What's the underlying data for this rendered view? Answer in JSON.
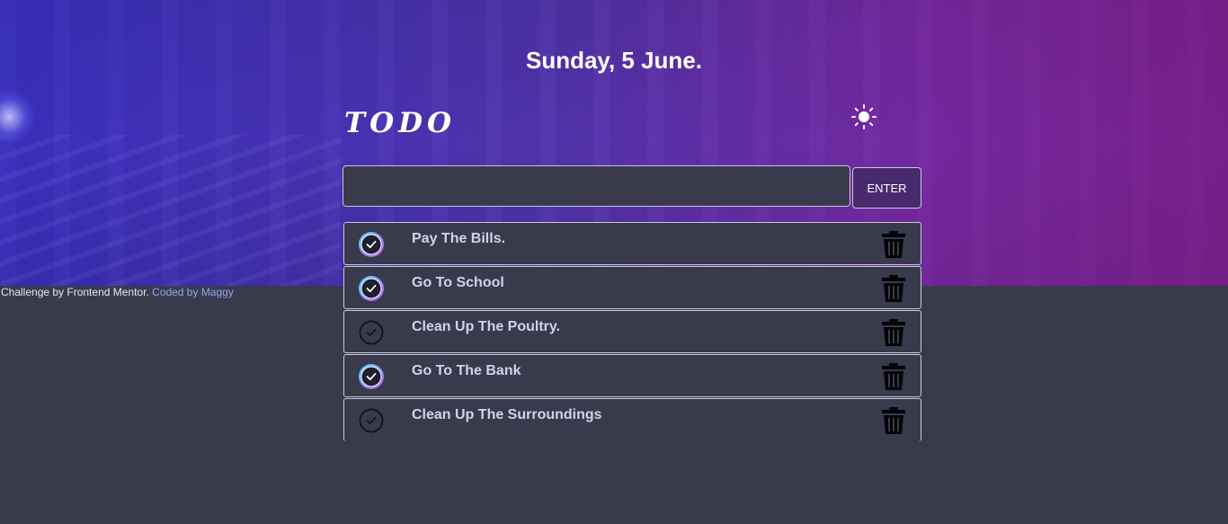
{
  "header": {
    "date": "Sunday, 5 June.",
    "logo": "TODO",
    "theme_icon": "sun-icon"
  },
  "input": {
    "value": "",
    "placeholder": "",
    "enter_label": "ENTER"
  },
  "todos": [
    {
      "text": "Pay The Bills.",
      "completed": true
    },
    {
      "text": "Go To School",
      "completed": true
    },
    {
      "text": "Clean Up The Poultry.",
      "completed": false
    },
    {
      "text": "Go To The Bank",
      "completed": true
    },
    {
      "text": "Clean Up The Surroundings",
      "completed": false
    }
  ],
  "footer": {
    "prefix": "Challenge by Frontend Mentor.",
    "link": "Coded by Maggy"
  },
  "colors": {
    "background": "#393a4c",
    "check_gradient_start": "#57ddff",
    "check_gradient_end": "#c058f3",
    "link": "#8fa8f0"
  }
}
